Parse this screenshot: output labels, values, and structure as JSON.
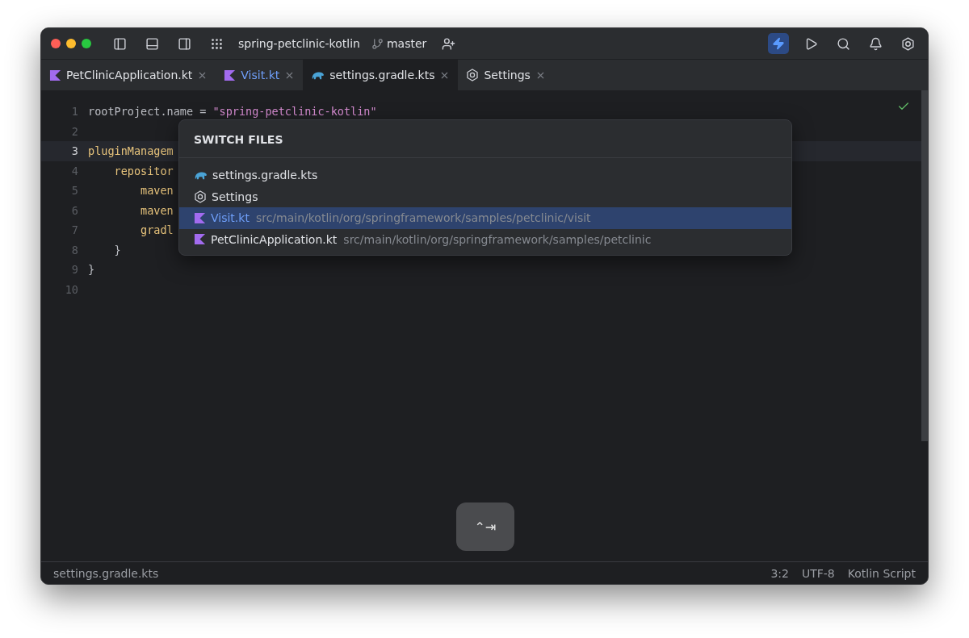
{
  "window": {
    "project": "spring-petclinic-kotlin",
    "branch": "master"
  },
  "toolbar": [
    {
      "kind": "bolt",
      "active": true
    },
    {
      "kind": "run",
      "active": false
    },
    {
      "kind": "search",
      "active": false
    },
    {
      "kind": "bell",
      "active": false
    },
    {
      "kind": "settings",
      "active": false
    }
  ],
  "tabs": [
    {
      "label": "PetClinicApplication.kt",
      "kind": "kotlin",
      "selected": false,
      "modified": false
    },
    {
      "label": "Visit.kt",
      "kind": "kotlin",
      "selected": false,
      "modified": true
    },
    {
      "label": "settings.gradle.kts",
      "kind": "gradle",
      "selected": true,
      "modified": false
    },
    {
      "label": "Settings",
      "kind": "settings",
      "selected": false,
      "modified": false
    }
  ],
  "editor": {
    "lines": [
      {
        "number": "1",
        "current": false,
        "tokens": [
          {
            "text": "rootProject.name = ",
            "kind": "plain"
          },
          {
            "text": "\"spring-petclinic-kotlin\"",
            "kind": "string"
          }
        ]
      },
      {
        "number": "2",
        "current": false
      },
      {
        "number": "3",
        "current": true,
        "tokens": [
          {
            "text": "pluginManagem",
            "kind": "call"
          }
        ]
      },
      {
        "number": "4",
        "current": false,
        "tokens": [
          {
            "text": "    repositor",
            "kind": "call"
          }
        ]
      },
      {
        "number": "5",
        "current": false,
        "tokens": [
          {
            "text": "        maven",
            "kind": "call"
          }
        ]
      },
      {
        "number": "6",
        "current": false,
        "tokens": [
          {
            "text": "        maven",
            "kind": "call"
          }
        ]
      },
      {
        "number": "7",
        "current": false,
        "tokens": [
          {
            "text": "        gradl",
            "kind": "call"
          }
        ]
      },
      {
        "number": "8",
        "current": false,
        "tokens": [
          {
            "text": "    }",
            "kind": "plain"
          }
        ]
      },
      {
        "number": "9",
        "current": false,
        "tokens": [
          {
            "text": "}",
            "kind": "plain"
          }
        ]
      },
      {
        "number": "10",
        "current": false
      }
    ]
  },
  "switcher": {
    "title": "SWITCH FILES",
    "items": [
      {
        "name": "settings.gradle.kts",
        "kind": "gradle",
        "selected": false,
        "modified": false
      },
      {
        "name": "Settings",
        "kind": "settings",
        "selected": false,
        "modified": false
      },
      {
        "name": "Visit.kt",
        "path": "src/main/kotlin/org/springframework/samples/petclinic/visit",
        "kind": "kotlin",
        "selected": true,
        "modified": true
      },
      {
        "name": "PetClinicApplication.kt",
        "path": "src/main/kotlin/org/springframework/samples/petclinic",
        "kind": "kotlin",
        "selected": false,
        "modified": false
      }
    ]
  },
  "shortcut_hint": "⌃⇥",
  "status_bar": {
    "file": "settings.gradle.kts",
    "position": "3:2",
    "encoding": "UTF-8",
    "language": "Kotlin Script"
  }
}
